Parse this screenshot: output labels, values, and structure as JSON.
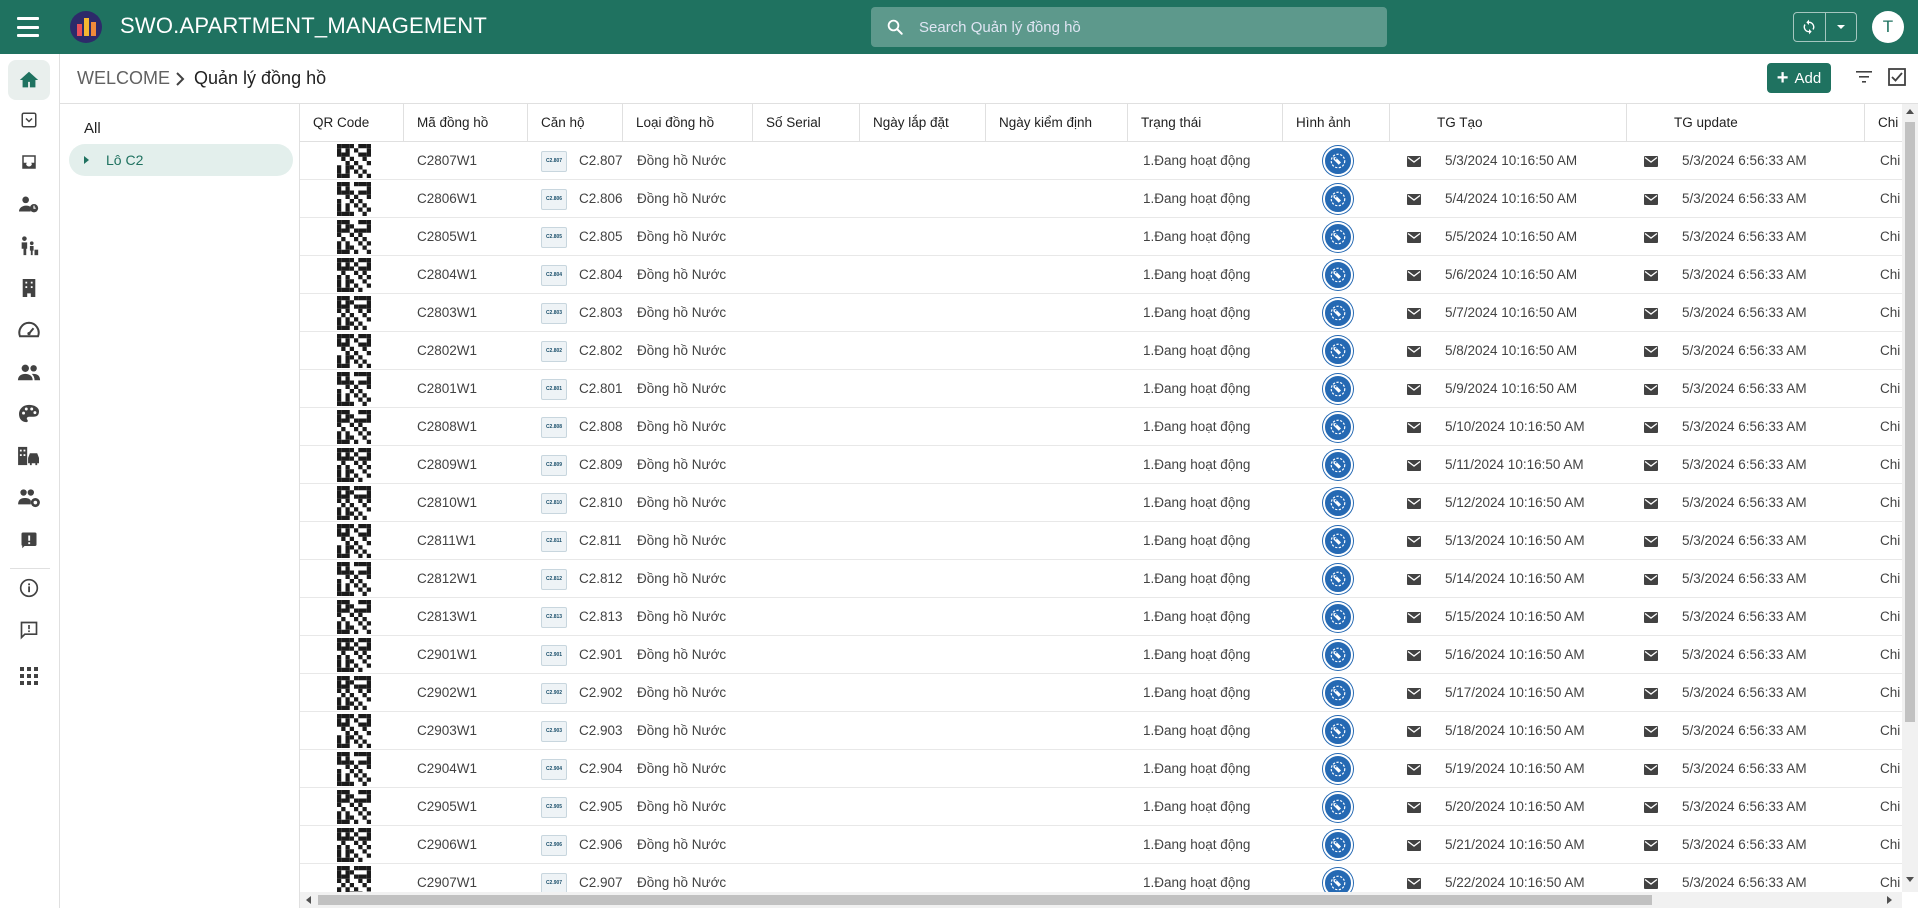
{
  "app": {
    "title": "SWO.APARTMENT_MANAGEMENT",
    "avatar_initial": "T"
  },
  "search": {
    "placeholder": "Search Quản lý đồng hồ"
  },
  "breadcrumb": {
    "root": "WELCOME",
    "current": "Quản lý đồng hồ"
  },
  "toolbar": {
    "add_label": "Add"
  },
  "tree": {
    "all_label": "All",
    "nodes": [
      {
        "label": "Lô C2"
      }
    ]
  },
  "rail_icons": [
    "home-icon",
    "inbox-down-icon",
    "inbox-icon",
    "person-clock-icon",
    "family-icon",
    "building-icon",
    "speedometer-icon",
    "group-icon",
    "palette-icon",
    "building-car-icon",
    "group-settings-icon",
    "alert-icon",
    "info-icon",
    "feedback-icon",
    "apps-icon"
  ],
  "grid": {
    "columns": [
      "QR Code",
      "Mã đồng hồ",
      "Căn hộ",
      "Loại đồng hồ",
      "Số Serial",
      "Ngày lắp đặt",
      "Ngày kiểm định",
      "Trạng thái",
      "Hình ảnh",
      "",
      "TG Tạo",
      "",
      "TG update",
      "Chi"
    ],
    "rows": [
      {
        "code": "C2807W1",
        "unit": "C2.807",
        "type": "Đồng hồ Nước",
        "status": "1.Đang hoạt động",
        "created": "5/3/2024 10:16:50 AM",
        "updated": "5/3/2024 6:56:33 AM",
        "extra": "Chi"
      },
      {
        "code": "C2806W1",
        "unit": "C2.806",
        "type": "Đồng hồ Nước",
        "status": "1.Đang hoạt động",
        "created": "5/4/2024 10:16:50 AM",
        "updated": "5/3/2024 6:56:33 AM",
        "extra": "Chi"
      },
      {
        "code": "C2805W1",
        "unit": "C2.805",
        "type": "Đồng hồ Nước",
        "status": "1.Đang hoạt động",
        "created": "5/5/2024 10:16:50 AM",
        "updated": "5/3/2024 6:56:33 AM",
        "extra": "Chi"
      },
      {
        "code": "C2804W1",
        "unit": "C2.804",
        "type": "Đồng hồ Nước",
        "status": "1.Đang hoạt động",
        "created": "5/6/2024 10:16:50 AM",
        "updated": "5/3/2024 6:56:33 AM",
        "extra": "Chi"
      },
      {
        "code": "C2803W1",
        "unit": "C2.803",
        "type": "Đồng hồ Nước",
        "status": "1.Đang hoạt động",
        "created": "5/7/2024 10:16:50 AM",
        "updated": "5/3/2024 6:56:33 AM",
        "extra": "Chi"
      },
      {
        "code": "C2802W1",
        "unit": "C2.802",
        "type": "Đồng hồ Nước",
        "status": "1.Đang hoạt động",
        "created": "5/8/2024 10:16:50 AM",
        "updated": "5/3/2024 6:56:33 AM",
        "extra": "Chi"
      },
      {
        "code": "C2801W1",
        "unit": "C2.801",
        "type": "Đồng hồ Nước",
        "status": "1.Đang hoạt động",
        "created": "5/9/2024 10:16:50 AM",
        "updated": "5/3/2024 6:56:33 AM",
        "extra": "Chi"
      },
      {
        "code": "C2808W1",
        "unit": "C2.808",
        "type": "Đồng hồ Nước",
        "status": "1.Đang hoạt động",
        "created": "5/10/2024 10:16:50 AM",
        "updated": "5/3/2024 6:56:33 AM",
        "extra": "Chi"
      },
      {
        "code": "C2809W1",
        "unit": "C2.809",
        "type": "Đồng hồ Nước",
        "status": "1.Đang hoạt động",
        "created": "5/11/2024 10:16:50 AM",
        "updated": "5/3/2024 6:56:33 AM",
        "extra": "Chi"
      },
      {
        "code": "C2810W1",
        "unit": "C2.810",
        "type": "Đồng hồ Nước",
        "status": "1.Đang hoạt động",
        "created": "5/12/2024 10:16:50 AM",
        "updated": "5/3/2024 6:56:33 AM",
        "extra": "Chi"
      },
      {
        "code": "C2811W1",
        "unit": "C2.811",
        "type": "Đồng hồ Nước",
        "status": "1.Đang hoạt động",
        "created": "5/13/2024 10:16:50 AM",
        "updated": "5/3/2024 6:56:33 AM",
        "extra": "Chi"
      },
      {
        "code": "C2812W1",
        "unit": "C2.812",
        "type": "Đồng hồ Nước",
        "status": "1.Đang hoạt động",
        "created": "5/14/2024 10:16:50 AM",
        "updated": "5/3/2024 6:56:33 AM",
        "extra": "Chi"
      },
      {
        "code": "C2813W1",
        "unit": "C2.813",
        "type": "Đồng hồ Nước",
        "status": "1.Đang hoạt động",
        "created": "5/15/2024 10:16:50 AM",
        "updated": "5/3/2024 6:56:33 AM",
        "extra": "Chi"
      },
      {
        "code": "C2901W1",
        "unit": "C2.901",
        "type": "Đồng hồ Nước",
        "status": "1.Đang hoạt động",
        "created": "5/16/2024 10:16:50 AM",
        "updated": "5/3/2024 6:56:33 AM",
        "extra": "Chi"
      },
      {
        "code": "C2902W1",
        "unit": "C2.902",
        "type": "Đồng hồ Nước",
        "status": "1.Đang hoạt động",
        "created": "5/17/2024 10:16:50 AM",
        "updated": "5/3/2024 6:56:33 AM",
        "extra": "Chi"
      },
      {
        "code": "C2903W1",
        "unit": "C2.903",
        "type": "Đồng hồ Nước",
        "status": "1.Đang hoạt động",
        "created": "5/18/2024 10:16:50 AM",
        "updated": "5/3/2024 6:56:33 AM",
        "extra": "Chi"
      },
      {
        "code": "C2904W1",
        "unit": "C2.904",
        "type": "Đồng hồ Nước",
        "status": "1.Đang hoạt động",
        "created": "5/19/2024 10:16:50 AM",
        "updated": "5/3/2024 6:56:33 AM",
        "extra": "Chi"
      },
      {
        "code": "C2905W1",
        "unit": "C2.905",
        "type": "Đồng hồ Nước",
        "status": "1.Đang hoạt động",
        "created": "5/20/2024 10:16:50 AM",
        "updated": "5/3/2024 6:56:33 AM",
        "extra": "Chi"
      },
      {
        "code": "C2906W1",
        "unit": "C2.906",
        "type": "Đồng hồ Nước",
        "status": "1.Đang hoạt động",
        "created": "5/21/2024 10:16:50 AM",
        "updated": "5/3/2024 6:56:33 AM",
        "extra": "Chi"
      },
      {
        "code": "C2907W1",
        "unit": "C2.907",
        "type": "Đồng hồ Nước",
        "status": "1.Đang hoạt động",
        "created": "5/22/2024 10:16:50 AM",
        "updated": "5/3/2024 6:56:33 AM",
        "extra": "Chi"
      }
    ]
  },
  "colors": {
    "brand": "#1f7260",
    "image_badge": "#2569b3"
  }
}
